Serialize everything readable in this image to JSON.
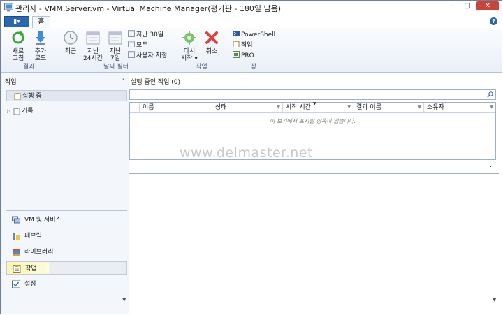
{
  "window": {
    "title": "관리자 - VMM.Server.vm - Virtual Machine Manager(평가판 - 180일 남음)",
    "buttons": {
      "minimize": "–",
      "restore": "▢",
      "close": "✕"
    }
  },
  "ribbon": {
    "file_label": "▮▾",
    "tab_home": "홈",
    "help": "?",
    "groups": {
      "results": {
        "label": "결과",
        "refresh": "새로\n고침",
        "load_more": "추가\n로드"
      },
      "date_filter": {
        "label": "날짜 필터",
        "recent": "최근",
        "last_24h": "지난\n24시간",
        "last_7d": "지난\n7일",
        "last_30d": "지난 30일",
        "all": "모두",
        "custom": "사용자 지정"
      },
      "job": {
        "label": "작업",
        "restart": "다시\n시작 ▾",
        "cancel": "취소"
      },
      "window_group": {
        "label": "창",
        "powershell": "PowerShell",
        "jobs": "작업",
        "pro": "PRO"
      }
    }
  },
  "left_pane": {
    "header": "작업",
    "collapse": "‹",
    "tree": [
      {
        "label": "실행 중",
        "selected": true
      },
      {
        "label": "기록",
        "expander": "▷"
      }
    ],
    "workspaces": [
      {
        "label": "VM 및 서비스",
        "icon": "vm-services-icon"
      },
      {
        "label": "패브릭",
        "icon": "fabric-icon"
      },
      {
        "label": "라이브러리",
        "icon": "library-icon"
      },
      {
        "label": "작업",
        "icon": "jobs-icon",
        "selected": true
      },
      {
        "label": "설정",
        "icon": "settings-icon"
      }
    ],
    "scroll_down": "▼"
  },
  "main": {
    "header": "실행 중인 작업 (0)",
    "search_placeholder": "",
    "columns": [
      "이름",
      "상태",
      "시작 시간",
      "결과 이름",
      "소유자"
    ],
    "sort_indicator": "▼",
    "empty_message": "이 보기에서 표시할 항목이 없습니다.",
    "details_toggle": "⌄",
    "scroll_down": "▼"
  },
  "watermark": "www.delmaster.net"
}
